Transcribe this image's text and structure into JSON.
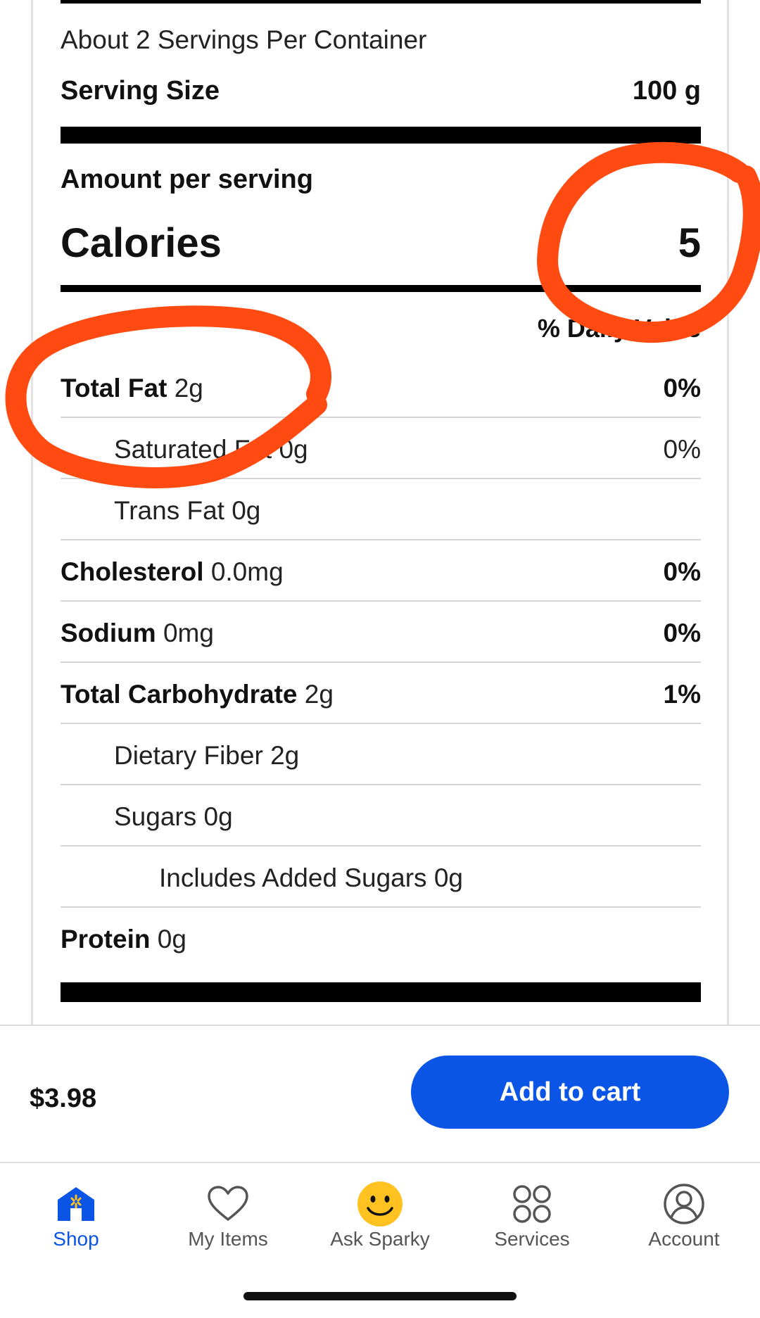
{
  "nutrition": {
    "servings_per_container": "About 2 Servings Per Container",
    "serving_size_label": "Serving Size",
    "serving_size_value": "100 g",
    "amount_per_serving": "Amount per serving",
    "calories_label": "Calories",
    "calories_value": "5",
    "daily_value_header": "% Daily Value",
    "rows": [
      {
        "name": "Total Fat",
        "amount": "2g",
        "dv": "0%"
      },
      {
        "name": "Saturated Fat",
        "amount": "0g",
        "dv": "0%"
      },
      {
        "name": "Trans Fat",
        "amount": "0g",
        "dv": ""
      },
      {
        "name": "Cholesterol",
        "amount": "0.0mg",
        "dv": "0%"
      },
      {
        "name": "Sodium",
        "amount": "0mg",
        "dv": "0%"
      },
      {
        "name": "Total Carbohydrate",
        "amount": "2g",
        "dv": "1%"
      },
      {
        "name": "Dietary Fiber",
        "amount": "2g",
        "dv": ""
      },
      {
        "name": "Sugars",
        "amount": "0g",
        "dv": ""
      },
      {
        "name": "Includes Added Sugars",
        "amount": "0g",
        "dv": ""
      },
      {
        "name": "Protein",
        "amount": "0g",
        "dv": ""
      }
    ]
  },
  "purchase": {
    "price": "$3.98",
    "add_to_cart_label": "Add to cart"
  },
  "tabs": [
    {
      "label": "Shop",
      "icon": "shop-icon",
      "active": true
    },
    {
      "label": "My Items",
      "icon": "heart-icon",
      "active": false
    },
    {
      "label": "Ask Sparky",
      "icon": "sparky-smiley-icon",
      "active": false
    },
    {
      "label": "Services",
      "icon": "services-grid-icon",
      "active": false
    },
    {
      "label": "Account",
      "icon": "account-icon",
      "active": false
    }
  ],
  "colors": {
    "accent_blue": "#0a55e6",
    "annotation_red": "#ff4a12",
    "sparky_yellow": "#ffc220"
  }
}
